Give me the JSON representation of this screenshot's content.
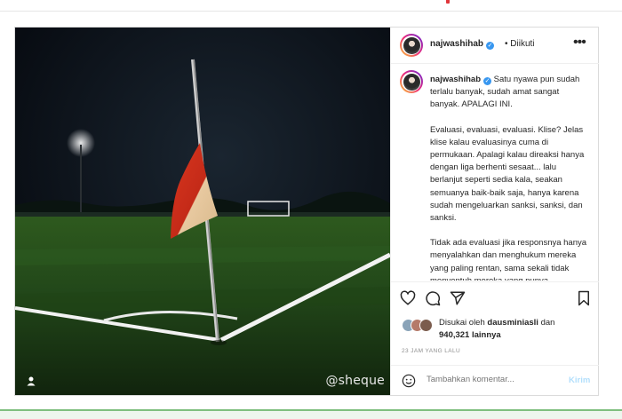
{
  "post": {
    "media": {
      "credit": "@sheque"
    },
    "header": {
      "username": "najwashihab",
      "separator": "•",
      "follow_label": "Diikuti"
    },
    "caption": {
      "username": "najwashihab",
      "paragraphs": [
        "Satu nyawa pun sudah terlalu banyak, sudah amat sangat banyak. APALAGI INI.",
        "Evaluasi, evaluasi, evaluasi. Klise? Jelas klise kalau evaluasinya cuma di permukaan. Apalagi kalau direaksi hanya dengan liga berhenti sesaat... lalu berlanjut seperti sedia kala, seakan semuanya baik-baik saja, hanya karena sudah mengeluarkan sanksi, sanksi, dan sanksi.",
        "Tidak ada evaluasi jika responsnya hanya menyalahkan dan menghukum mereka yang paling rentan, sama sekali tidak menyentuh mereka yang punya kewenangan, dan berakhir"
      ]
    },
    "likes": {
      "prefix": "Disukai oleh",
      "user": "dausminiasli",
      "conj": "dan",
      "count": "940,321",
      "suffix": "lainnya"
    },
    "timestamp": "23 JAM YANG LALU",
    "comment": {
      "placeholder": "Tambahkan komentar...",
      "post_label": "Kirim"
    },
    "icons": [
      "heart-icon",
      "comment-icon",
      "share-icon",
      "bookmark-icon",
      "more-options-icon",
      "emoji-icon",
      "verified-icon",
      "user-tag-icon"
    ]
  }
}
